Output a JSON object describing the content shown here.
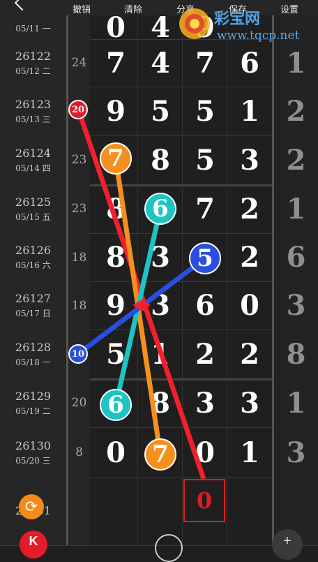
{
  "toolbar": {
    "undo": "撤销",
    "clear": "清除",
    "share": "分享",
    "save": "保存",
    "settings": "设置"
  },
  "watermark": {
    "brand": "彩宝网",
    "url": "www.tqcp.net"
  },
  "rows": [
    {
      "issue": "",
      "date": "05/11 一",
      "gap": "",
      "digits": [
        "0",
        "4",
        "9",
        "",
        ""
      ],
      "sum": ""
    },
    {
      "issue": "26122",
      "date": "05/12 二",
      "gap": "24",
      "digits": [
        "7",
        "4",
        "7",
        "6"
      ],
      "sum": "1"
    },
    {
      "issue": "26123",
      "date": "05/13 三",
      "gap": "",
      "digits": [
        "9",
        "5",
        "5",
        "1"
      ],
      "sum": "2"
    },
    {
      "issue": "26124",
      "date": "05/14 四",
      "gap": "23",
      "digits": [
        "",
        "8",
        "5",
        "3"
      ],
      "sum": "2"
    },
    {
      "issue": "26125",
      "date": "05/15 五",
      "gap": "23",
      "digits": [
        "8",
        "",
        "7",
        "2"
      ],
      "sum": "1"
    },
    {
      "issue": "26126",
      "date": "05/16 六",
      "gap": "18",
      "digits": [
        "8",
        "3",
        "",
        "2"
      ],
      "sum": "6"
    },
    {
      "issue": "26127",
      "date": "05/17 日",
      "gap": "18",
      "digits": [
        "9",
        "3",
        "6",
        "0"
      ],
      "sum": "3"
    },
    {
      "issue": "26128",
      "date": "05/18 一",
      "gap": "",
      "digits": [
        "5",
        "1",
        "2",
        "2"
      ],
      "sum": "8"
    },
    {
      "issue": "26129",
      "date": "05/19 二",
      "gap": "20",
      "digits": [
        "",
        "8",
        "3",
        "3"
      ],
      "sum": "1"
    },
    {
      "issue": "26130",
      "date": "05/20 三",
      "gap": "8",
      "digits": [
        "0",
        "",
        "0",
        "1"
      ],
      "sum": "3"
    },
    {
      "issue": "26131",
      "date": "",
      "gap": "",
      "digits": [
        "",
        "",
        "",
        ""
      ],
      "sum": ""
    }
  ],
  "balls": [
    {
      "label": "20",
      "color": "#e01c2c"
    },
    {
      "label": "7",
      "color": "#f5901e"
    },
    {
      "label": "6",
      "color": "#1ec4c4"
    },
    {
      "label": "5",
      "color": "#2a4ee0"
    },
    {
      "label": "10",
      "color": "#2a4ee0"
    },
    {
      "label": "6",
      "color": "#1ec4c4"
    },
    {
      "label": "7",
      "color": "#f5901e"
    }
  ],
  "prediction": "0",
  "colors": {
    "red": "#f0202c",
    "orange": "#f5901e",
    "cyan": "#1ec4c4",
    "blue": "#2a4ee0"
  }
}
